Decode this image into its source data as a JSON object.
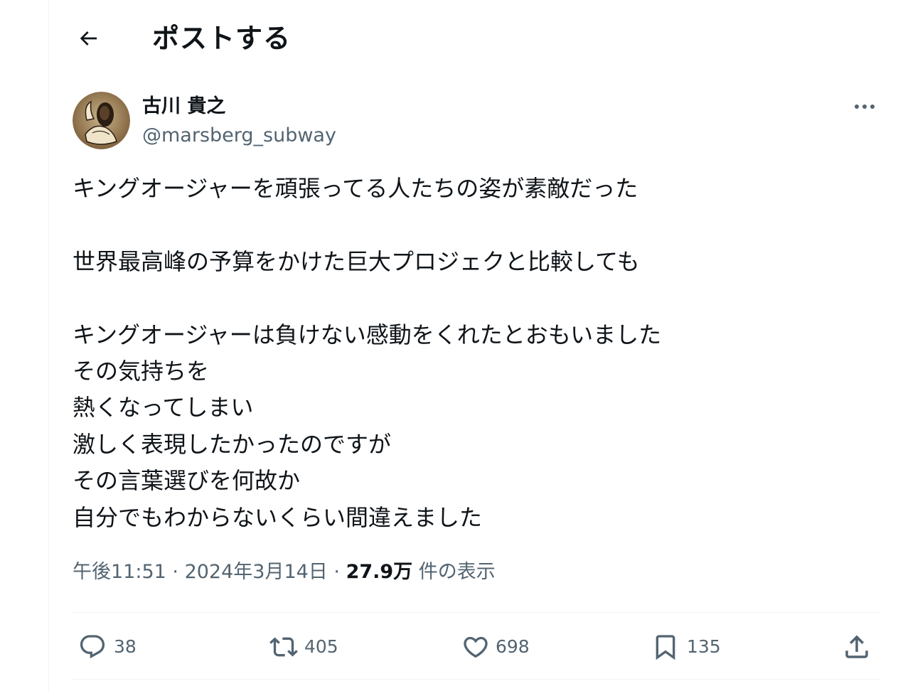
{
  "header": {
    "title": "ポストする"
  },
  "author": {
    "display_name": "古川 貴之",
    "username": "@marsberg_subway"
  },
  "tweet": {
    "lines": [
      "キングオージャーを頑張ってる人たちの姿が素敵だった",
      "",
      "世界最高峰の予算をかけた巨大プロジェクと比較しても",
      "",
      "キングオージャーは負けない感動をくれたとおもいました",
      "その気持ちを",
      "熱くなってしまい",
      "激しく表現したかったのですが",
      "その言葉選びを何故か",
      "自分でもわからないくらい間違えました"
    ]
  },
  "meta": {
    "time": "午後11:51",
    "separator": " · ",
    "date": "2024年3月14日",
    "views_count": "27.9万",
    "views_label": " 件の表示"
  },
  "actions": {
    "reply_count": "38",
    "repost_count": "405",
    "like_count": "698",
    "bookmark_count": "135"
  },
  "icons": {
    "back": "arrow-left-icon",
    "more": "more-dots-icon",
    "reply": "reply-bubble-icon",
    "repost": "repost-arrows-icon",
    "like": "heart-icon",
    "bookmark": "bookmark-icon",
    "share": "share-upload-icon"
  },
  "colors": {
    "text_primary": "#0f1419",
    "text_secondary": "#536471",
    "divider": "#eff3f4"
  }
}
